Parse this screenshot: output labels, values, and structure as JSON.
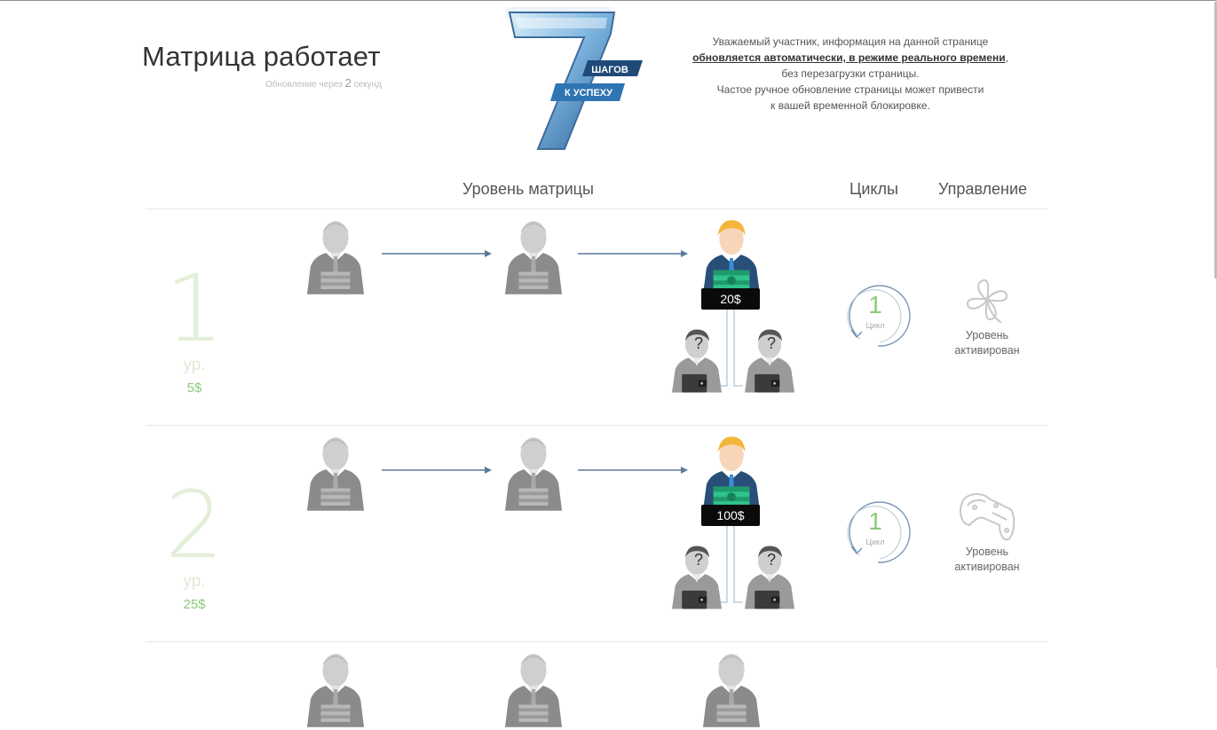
{
  "header": {
    "title": "Матрица работает",
    "update_prefix": "Обновление через",
    "update_seconds": "2",
    "update_suffix": "секунд"
  },
  "logo": {
    "number": "7",
    "line1": "ШАГОВ",
    "line2": "К УСПЕХУ"
  },
  "notice": {
    "part1": "Уважаемый участник, информация на данной странице",
    "link": "обновляется автоматически, в режиме реального времени",
    "part2": ", без перезагрузки страницы.",
    "line3": "Частое ручное обновление страницы может привести",
    "line4": "к вашей временной блокировке."
  },
  "columns": {
    "matrix": "Уровень матрицы",
    "cycles": "Циклы",
    "manage": "Управление"
  },
  "levels": [
    {
      "number": "1",
      "ur": "ур.",
      "price": "5$",
      "payout": "20$",
      "cycle_count": "1",
      "cycle_label": "Цикл",
      "manage_icon": "clover-icon",
      "status_line1": "Уровень",
      "status_line2": "активирован"
    },
    {
      "number": "2",
      "ur": "ур.",
      "price": "25$",
      "payout": "100$",
      "cycle_count": "1",
      "cycle_label": "Цикл",
      "manage_icon": "horseshoe-icon",
      "status_line1": "Уровень",
      "status_line2": "активирован"
    }
  ],
  "colors": {
    "accent_green": "#8cc97a",
    "level_faded": "#e3efd9",
    "arrow": "#5a7a9a",
    "price_tag_bg": "#0a0a0a"
  }
}
